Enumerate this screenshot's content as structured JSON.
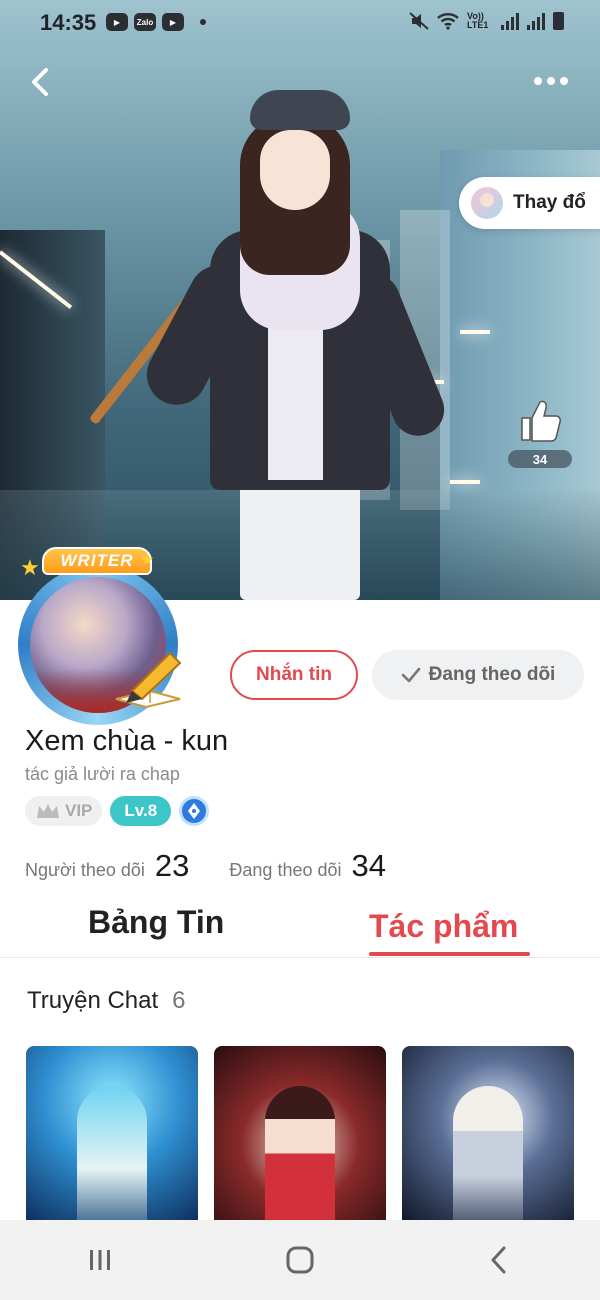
{
  "status_bar": {
    "time": "14:35",
    "notification_icons": [
      "youtube-icon",
      "zalo-icon",
      "youtube-icon"
    ],
    "zalo_label": "Zalo",
    "network_label": "Vo)) LTE1"
  },
  "cover": {
    "change_cover_label": "Thay đổ",
    "like_count": "34"
  },
  "profile": {
    "writer_badge": "WRITER",
    "message_button": "Nhắn tin",
    "following_button": "Đang theo dõi",
    "name": "Xem chùa - kun",
    "bio": "tác giả lười ra chap",
    "vip_label": "VIP",
    "level_label": "Lv.8",
    "followers_label": "Người theo dõi",
    "followers_count": "23",
    "following_label": "Đang theo dõi",
    "following_count": "34"
  },
  "tabs": {
    "news": "Bảng Tin",
    "works": "Tác phẩm",
    "active": "works"
  },
  "section": {
    "title": "Truyện Chat",
    "count": "6"
  },
  "colors": {
    "accent": "#e24a50",
    "level_badge": "#3cc6c8",
    "pen_badge": "#2f7bdc"
  }
}
